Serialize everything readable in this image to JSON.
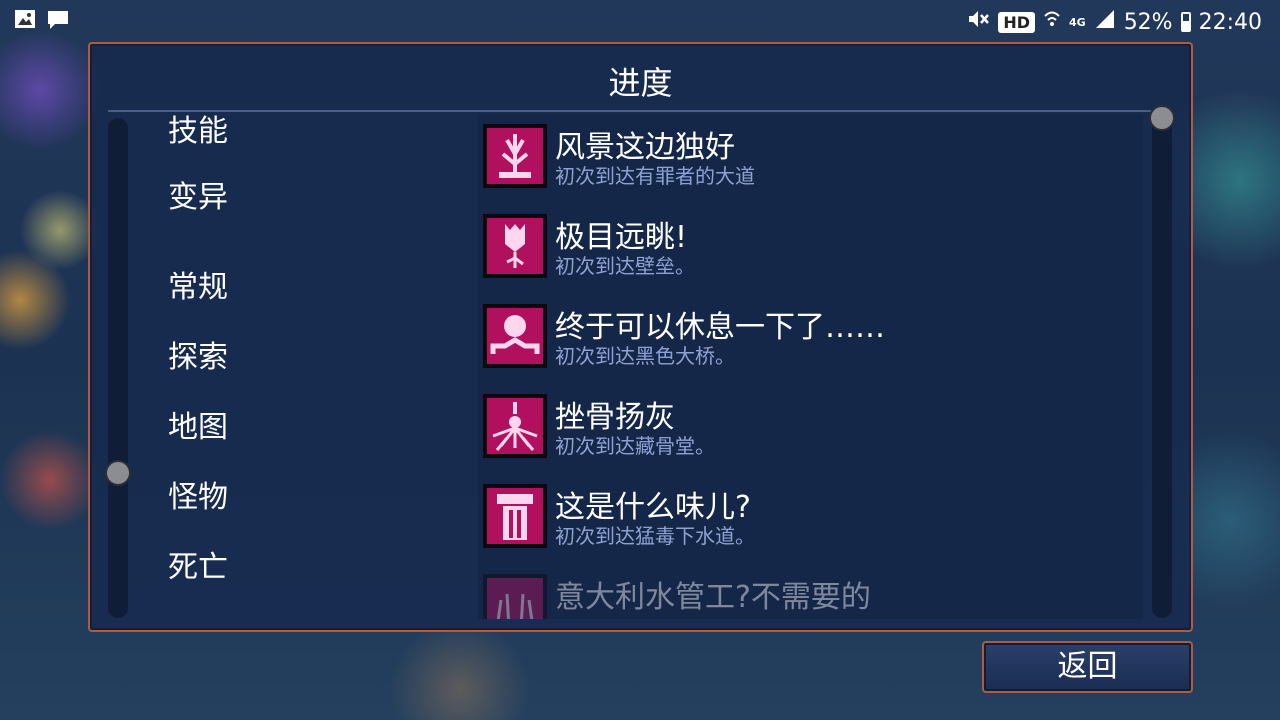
{
  "status_bar": {
    "left_icons": [
      "gallery-icon",
      "message-icon"
    ],
    "hd_label": "HD",
    "network": "4G",
    "battery": "52%",
    "time": "22:40"
  },
  "panel": {
    "title": "进度",
    "categories": [
      {
        "label": "技能"
      },
      {
        "label": "变异"
      },
      {
        "label": "常规"
      },
      {
        "label": "探索"
      },
      {
        "label": "地图"
      },
      {
        "label": "怪物"
      },
      {
        "label": "死亡"
      }
    ],
    "achievements": [
      {
        "title": "风景这边独好",
        "desc": "初次到达有罪者的大道",
        "icon": "tree-icon"
      },
      {
        "title": "极目远眺!",
        "desc": "初次到达壁垒。",
        "icon": "tower-icon"
      },
      {
        "title": "终于可以休息一下了……",
        "desc": "初次到达黑色大桥。",
        "icon": "bridge-icon"
      },
      {
        "title": "挫骨扬灰",
        "desc": "初次到达藏骨堂。",
        "icon": "bone-burst-icon"
      },
      {
        "title": "这是什么味儿?",
        "desc": "初次到达猛毒下水道。",
        "icon": "pipe-icon"
      },
      {
        "title": "意大利水管工?不需要的",
        "desc": "",
        "icon": "grass-icon"
      }
    ]
  },
  "back_button": {
    "label": "返回"
  },
  "colors": {
    "accent": "#e0157d",
    "border": "#b05a42",
    "desc_text": "#8ea2d2"
  }
}
